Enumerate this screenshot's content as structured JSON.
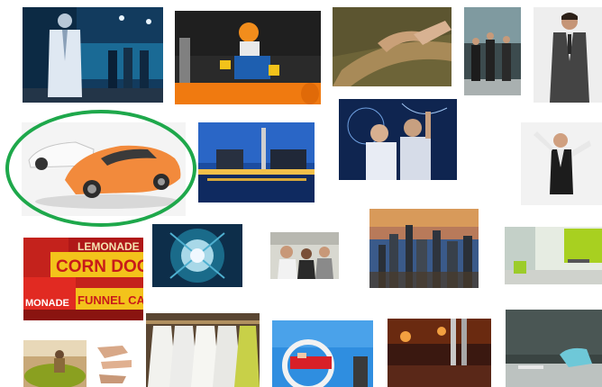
{
  "gallery": {
    "selected_item": "sports-cars",
    "highlight_color": "#1ea84b",
    "signs": {
      "lemonade_top": "LEMONADE",
      "corn_dogs": "CORN DOGS",
      "lemonade_bottom": "MONADE",
      "funnel_cake": "FUNNEL CAK"
    }
  }
}
